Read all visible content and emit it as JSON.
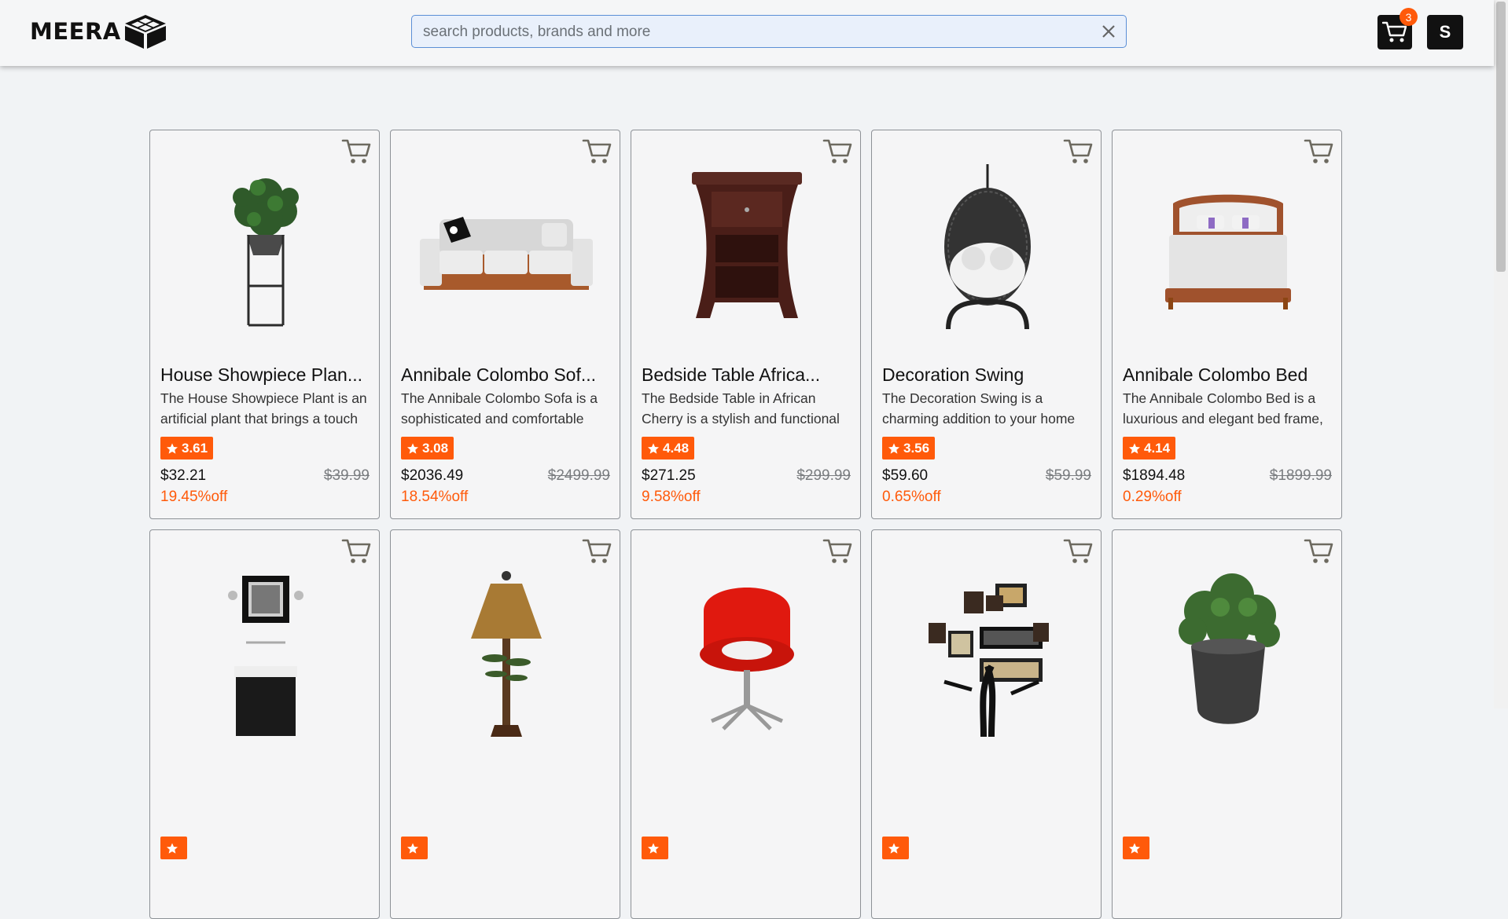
{
  "header": {
    "logo_text": "MEERA",
    "search_placeholder": "search products, brands and more",
    "search_value": "",
    "cart_count": "3",
    "avatar_initial": "S"
  },
  "colors": {
    "accent": "#ff5a0a",
    "dark": "#111111",
    "search_border": "#5b8fd6"
  },
  "products": [
    {
      "title": "House Showpiece Plan...",
      "desc": "The House Showpiece Plant is an artificial plant that brings a touch",
      "rating": "3.61",
      "price": "$32.21",
      "old_price": "$39.99",
      "discount": "19.45%off",
      "icon": "potted-plant-stand"
    },
    {
      "title": "Annibale Colombo Sof...",
      "desc": "The Annibale Colombo Sofa is a sophisticated and comfortable",
      "rating": "3.08",
      "price": "$2036.49",
      "old_price": "$2499.99",
      "discount": "18.54%off",
      "icon": "sofa"
    },
    {
      "title": "Bedside Table Africa...",
      "desc": "The Bedside Table in African Cherry is a stylish and functional",
      "rating": "4.48",
      "price": "$271.25",
      "old_price": "$299.99",
      "discount": "9.58%off",
      "icon": "bedside-table"
    },
    {
      "title": "Decoration Swing",
      "desc": "The Decoration Swing is a charming addition to your home",
      "rating": "3.56",
      "price": "$59.60",
      "old_price": "$59.99",
      "discount": "0.65%off",
      "icon": "hanging-swing-chair"
    },
    {
      "title": "Annibale Colombo Bed",
      "desc": "The Annibale Colombo Bed is a luxurious and elegant bed frame,",
      "rating": "4.14",
      "price": "$1894.48",
      "old_price": "$1899.99",
      "discount": "0.29%off",
      "icon": "bed"
    },
    {
      "title": "",
      "desc": "",
      "rating": "",
      "price": "",
      "old_price": "",
      "discount": "",
      "icon": "bathroom-vanity"
    },
    {
      "title": "",
      "desc": "",
      "rating": "",
      "price": "",
      "old_price": "",
      "discount": "",
      "icon": "table-lamp"
    },
    {
      "title": "",
      "desc": "",
      "rating": "",
      "price": "",
      "old_price": "",
      "discount": "",
      "icon": "red-chair"
    },
    {
      "title": "",
      "desc": "",
      "rating": "",
      "price": "",
      "old_price": "",
      "discount": "",
      "icon": "family-tree-frame"
    },
    {
      "title": "",
      "desc": "",
      "rating": "",
      "price": "",
      "old_price": "",
      "discount": "",
      "icon": "potted-plant"
    }
  ]
}
